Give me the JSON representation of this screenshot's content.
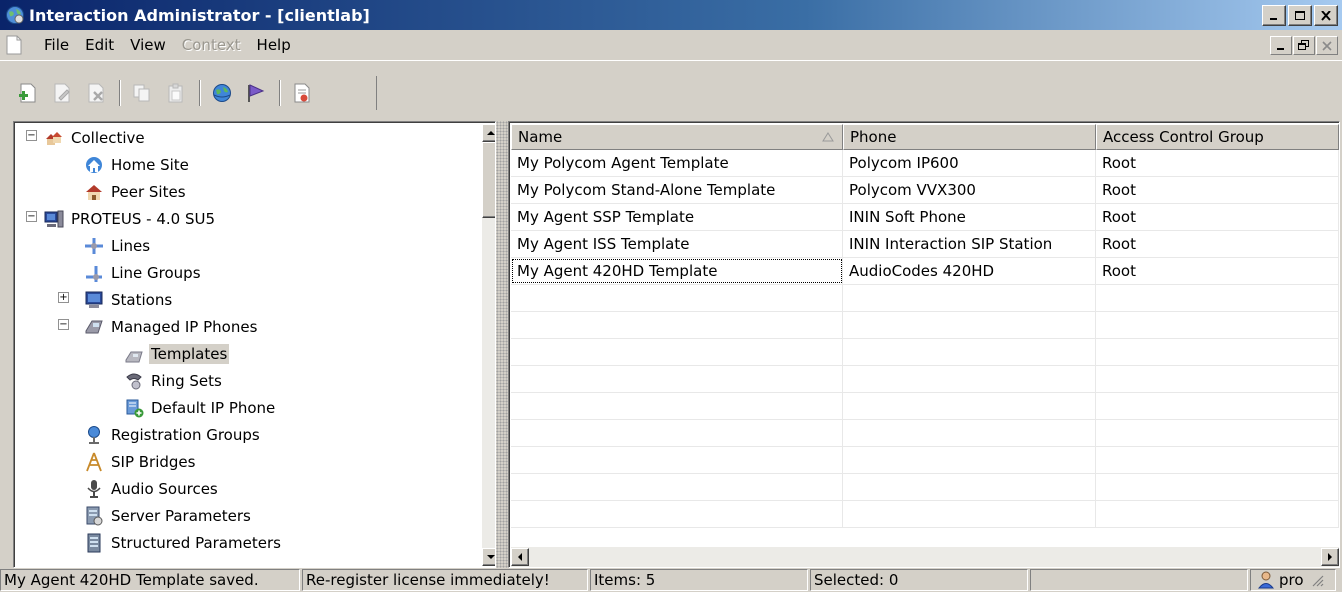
{
  "window": {
    "title": "Interaction Administrator - [clientlab]"
  },
  "menu": {
    "items": [
      {
        "label": "File",
        "enabled": true
      },
      {
        "label": "Edit",
        "enabled": true
      },
      {
        "label": "View",
        "enabled": true
      },
      {
        "label": "Context",
        "enabled": false
      },
      {
        "label": "Help",
        "enabled": true
      }
    ]
  },
  "toolbar": {
    "buttons": [
      "new-icon",
      "edit-icon",
      "delete-icon",
      "copy-icon",
      "paste-icon",
      "globe-icon",
      "flag-icon",
      "report-icon"
    ]
  },
  "tree": {
    "items": [
      {
        "label": "Collective",
        "icon": "collective-icon",
        "expander": "minus"
      },
      {
        "label": "Home Site",
        "icon": "home-site-icon"
      },
      {
        "label": "Peer Sites",
        "icon": "peer-sites-icon"
      },
      {
        "label": "PROTEUS - 4.0 SU5",
        "icon": "server-icon",
        "expander": "minus"
      },
      {
        "label": "Lines",
        "icon": "lines-icon"
      },
      {
        "label": "Line Groups",
        "icon": "line-groups-icon"
      },
      {
        "label": "Stations",
        "icon": "stations-icon",
        "expander": "plus"
      },
      {
        "label": "Managed IP Phones",
        "icon": "ip-phones-icon",
        "expander": "minus"
      },
      {
        "label": "Templates",
        "icon": "templates-icon",
        "selected": true
      },
      {
        "label": "Ring Sets",
        "icon": "ring-sets-icon"
      },
      {
        "label": "Default IP Phone",
        "icon": "default-ip-phone-icon"
      },
      {
        "label": "Registration Groups",
        "icon": "registration-groups-icon"
      },
      {
        "label": "SIP Bridges",
        "icon": "sip-bridges-icon"
      },
      {
        "label": "Audio Sources",
        "icon": "audio-sources-icon"
      },
      {
        "label": "Server Parameters",
        "icon": "server-parameters-icon"
      },
      {
        "label": "Structured Parameters",
        "icon": "structured-parameters-icon"
      }
    ]
  },
  "list": {
    "columns": [
      "Name",
      "Phone",
      "Access Control Group"
    ],
    "rows": [
      [
        "My Polycom Agent Template",
        "Polycom IP600",
        "Root"
      ],
      [
        "My Polycom Stand-Alone Template",
        "Polycom VVX300",
        "Root"
      ],
      [
        "My Agent SSP Template",
        "ININ Soft Phone",
        "Root"
      ],
      [
        "My Agent ISS Template",
        "ININ Interaction SIP Station",
        "Root"
      ],
      [
        "My Agent 420HD Template",
        "AudioCodes 420HD",
        "Root"
      ]
    ]
  },
  "status": {
    "message": "My Agent 420HD Template saved.",
    "license": "Re-register license immediately!",
    "items": "Items: 5",
    "selected": "Selected: 0",
    "empty": "",
    "user": "pro"
  }
}
